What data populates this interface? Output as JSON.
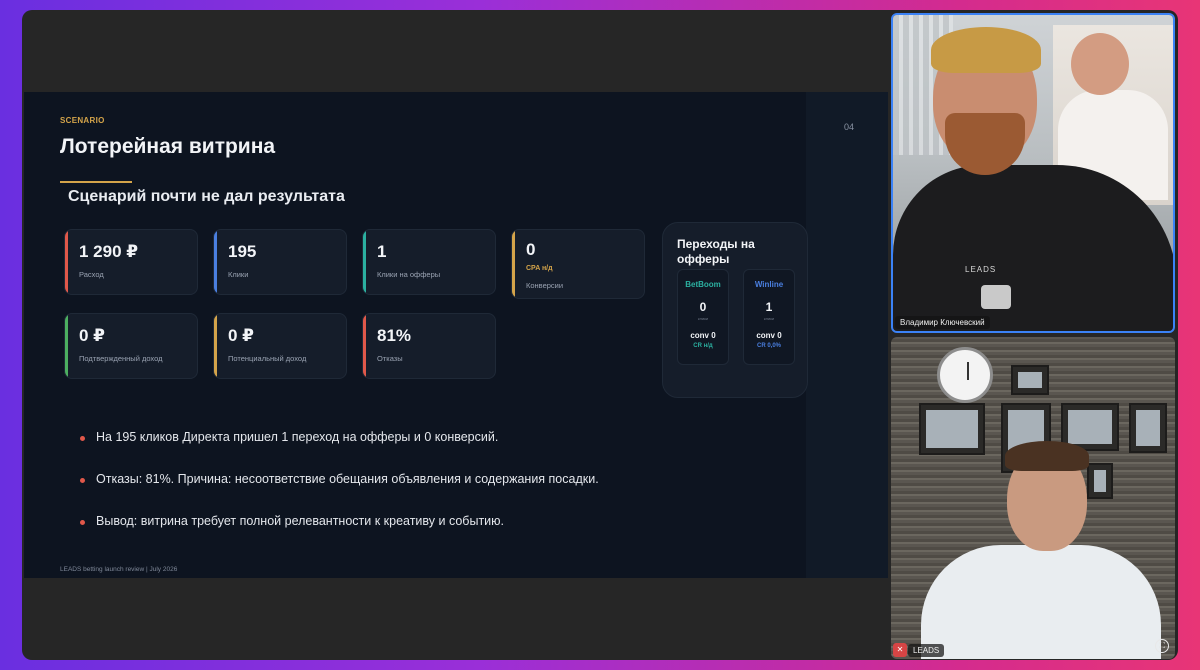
{
  "slide": {
    "page_number": "04",
    "kicker": "SCENARIO",
    "title": "Лотерейная витрина",
    "subtitle": "Сценарий почти не дал результата",
    "cards": [
      {
        "value": "1 290 ₽",
        "label": "Расход",
        "accent": "#e0584a"
      },
      {
        "value": "195",
        "label": "Клики",
        "accent": "#4a7fe0"
      },
      {
        "value": "1",
        "label": "Клики на офферы",
        "accent": "#2bb0a0"
      },
      {
        "value": "0",
        "sub": "CPA н/д",
        "label": "Конверсии",
        "accent": "#d4a44a"
      },
      {
        "value": "0 ₽",
        "label": "Подтвержденный доход",
        "accent": "#4caf60"
      },
      {
        "value": "0 ₽",
        "label": "Потенциальный доход",
        "accent": "#d4a44a"
      },
      {
        "value": "81%",
        "label": "Отказы",
        "accent": "#e0584a"
      }
    ],
    "offers": {
      "title": "Переходы на офферы",
      "items": [
        {
          "name": "BetBoom",
          "clicks": "0",
          "clicks_label": "клики",
          "conv": "conv 0",
          "cr": "CR н/д",
          "name_color": "#2bb0a0",
          "cr_color": "#2bb0a0"
        },
        {
          "name": "Winline",
          "clicks": "1",
          "clicks_label": "клики",
          "conv": "conv 0",
          "cr": "CR 0,0%",
          "name_color": "#4a7fe0",
          "cr_color": "#4a7fe0"
        }
      ]
    },
    "bullets": [
      "На 195 кликов Директа пришел 1 переход на офферы и 0 конверсий.",
      "Отказы: 81%. Причина: несоответствие обещания объявления и содержания посадки.",
      "Вывод: витрина требует полной релевантности к креативу и событию."
    ],
    "footer": "LEADS betting launch review | July 2026"
  },
  "participants": [
    {
      "name": "Владимир Ключевский",
      "shirt_logo": "LEADS"
    },
    {
      "name": "LEADS",
      "mic_icon": "mic-muted-icon"
    }
  ]
}
